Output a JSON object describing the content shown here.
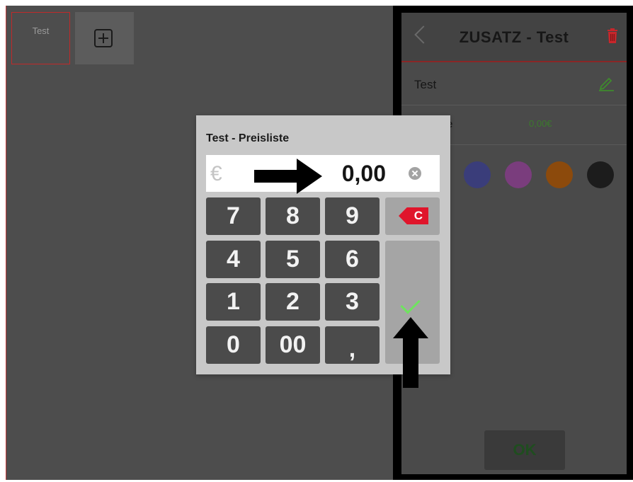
{
  "canvas": {
    "tile_label": "Test"
  },
  "side_panel": {
    "title": "ZUSATZ - Test",
    "name_label": "Test",
    "price_label_partial": "e",
    "price_value": "0,00€",
    "swatches": [
      "#3a3d7a",
      "#7a3d7d",
      "#8c4a0c",
      "#1c1c1c"
    ],
    "ok_label": "OK"
  },
  "numpad_dialog": {
    "title": "Test - Preisliste",
    "currency_symbol": "€",
    "amount": "0,00",
    "keys": {
      "k7": "7",
      "k8": "8",
      "k9": "9",
      "k4": "4",
      "k5": "5",
      "k6": "6",
      "k1": "1",
      "k2": "2",
      "k3": "3",
      "k0": "0",
      "k00": "00",
      "comma": ",",
      "clear": "C"
    }
  },
  "colors": {
    "accent_red": "#e0152b",
    "confirm_green": "#6fe35f"
  }
}
